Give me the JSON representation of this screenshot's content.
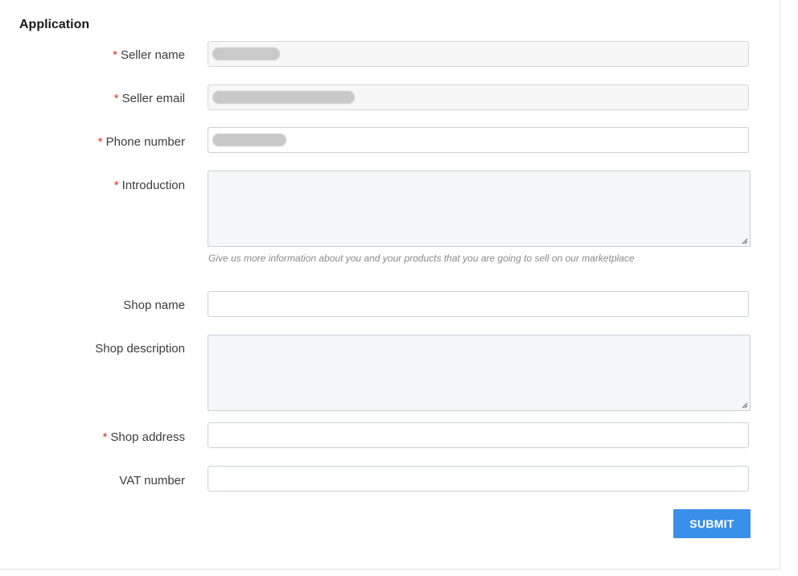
{
  "section": {
    "title": "Application"
  },
  "fields": {
    "seller_name": {
      "label": "Seller name",
      "required": "*"
    },
    "seller_email": {
      "label": "Seller email",
      "required": "*"
    },
    "phone_number": {
      "label": "Phone number",
      "required": "*"
    },
    "introduction": {
      "label": "Introduction",
      "required": "*",
      "hint": "Give us more information about you and your products that you are going to sell on our marketplace"
    },
    "shop_name": {
      "label": "Shop name"
    },
    "shop_description": {
      "label": "Shop description"
    },
    "shop_address": {
      "label": "Shop address",
      "required": "*"
    },
    "vat_number": {
      "label": "VAT number"
    }
  },
  "actions": {
    "submit_label": "SUBMIT"
  },
  "colors": {
    "accent": "#3a8fe8",
    "required": "#e0301e"
  }
}
